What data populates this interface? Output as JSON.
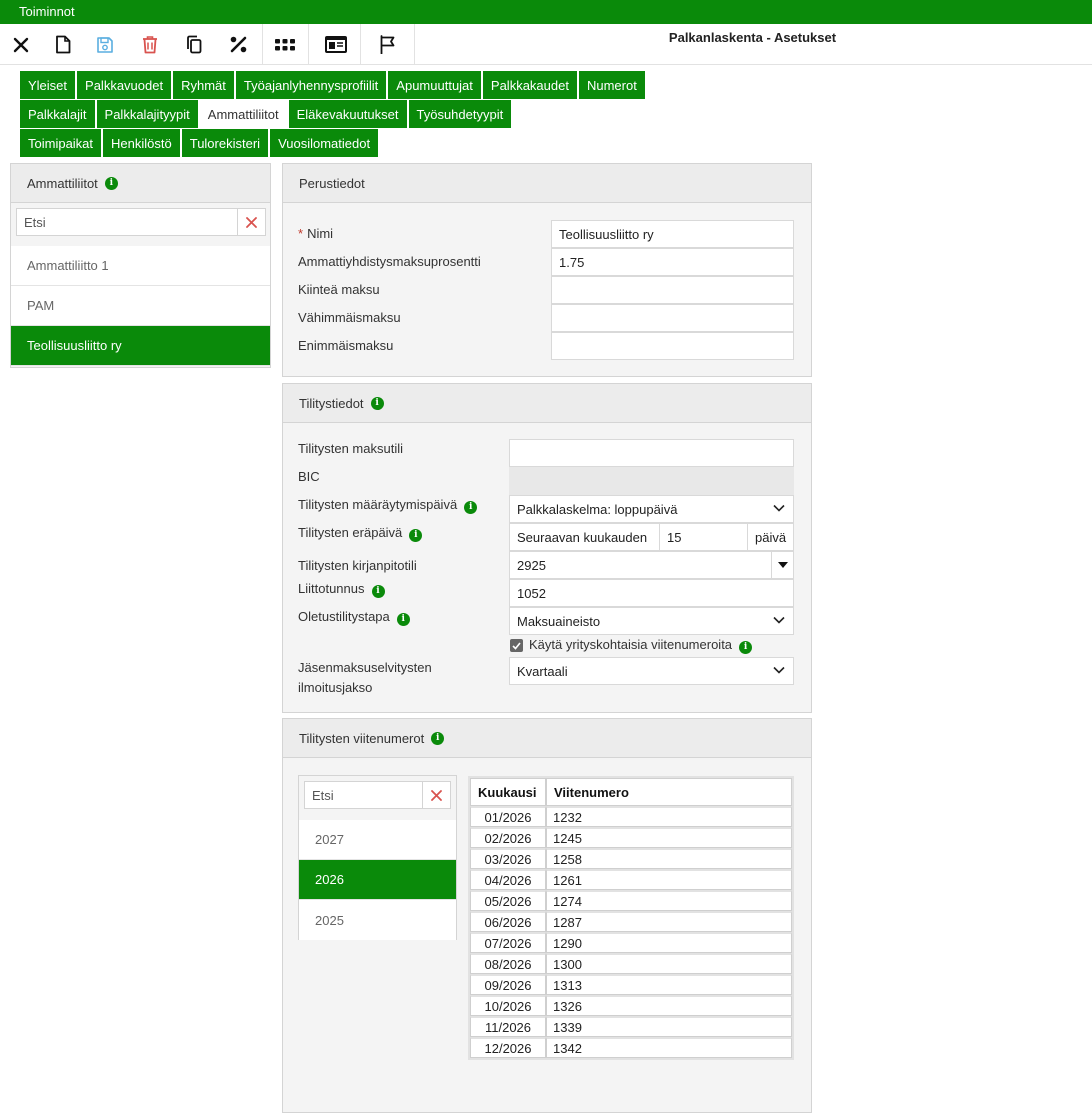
{
  "menu": {
    "title": "Toiminnot"
  },
  "toolbar": {
    "icons": [
      "close-icon",
      "new-document-icon",
      "save-icon",
      "delete-icon",
      "copy-icon",
      "percent-icon",
      "grid-icon",
      "id-card-icon",
      "flag-icon"
    ],
    "app_title": "Palkanlaskenta - Asetukset"
  },
  "tabs": {
    "row1": [
      "Yleiset",
      "Palkkavuodet",
      "Ryhmät",
      "Työajanlyhennysprofiilit",
      "Apumuuttujat",
      "Palkkakaudet",
      "Numerot"
    ],
    "row2": [
      "Palkkalajit",
      "Palkkalajityypit",
      "Ammattiliitot",
      "Eläkevakuutukset",
      "Työsuhdetyypit"
    ],
    "row3": [
      "Toimipaikat",
      "Henkilöstö",
      "Tulorekisteri",
      "Vuosilomatiedot"
    ],
    "active": "Ammattiliitot"
  },
  "sidebar": {
    "title": "Ammattiliitot",
    "search_placeholder": "Etsi",
    "items": [
      "Ammattiliitto 1",
      "PAM",
      "Teollisuusliitto ry"
    ],
    "selected": "Teollisuusliitto ry"
  },
  "basic": {
    "title": "Perustiedot",
    "required_mark": "*",
    "name_label": "Nimi",
    "name_value": "Teollisuusliitto ry",
    "percent_label": "Ammattiyhdistysmaksuprosentti",
    "percent_value": "1.75",
    "fixed_label": "Kiinteä maksu",
    "fixed_value": "",
    "min_label": "Vähimmäismaksu",
    "min_value": "",
    "max_label": "Enimmäismaksu",
    "max_value": ""
  },
  "settlement": {
    "title": "Tilitystiedot",
    "account_label": "Tilitysten maksutili",
    "account_value": "",
    "bic_label": "BIC",
    "bic_value": "",
    "determination_label": "Tilitysten määräytymispäivä",
    "determination_value": "Palkkalaskelma: loppupäivä",
    "due_label": "Tilitysten eräpäivä",
    "due_prefix": "Seuraavan kuukauden",
    "due_day": "15",
    "due_suffix": "päivä",
    "bookkeeping_label": "Tilitysten kirjanpitotili",
    "bookkeeping_value": "2925",
    "union_code_label": "Liittotunnus",
    "union_code_value": "1052",
    "method_label": "Oletustilitystapa",
    "method_value": "Maksuaineisto",
    "company_refs_label": "Käytä yrityskohtaisia viitenumeroita",
    "company_refs_checked": true,
    "report_period_label_1": "Jäsenmaksuselvitysten",
    "report_period_label_2": "ilmoitusjakso",
    "report_period_value": "Kvartaali"
  },
  "references": {
    "title": "Tilitysten viitenumerot",
    "search_placeholder": "Etsi",
    "years": [
      "2027",
      "2026",
      "2025"
    ],
    "selected_year": "2026",
    "headers": [
      "Kuukausi",
      "Viitenumero"
    ],
    "rows": [
      [
        "01/2026",
        "1232"
      ],
      [
        "02/2026",
        "1245"
      ],
      [
        "03/2026",
        "1258"
      ],
      [
        "04/2026",
        "1261"
      ],
      [
        "05/2026",
        "1274"
      ],
      [
        "06/2026",
        "1287"
      ],
      [
        "07/2026",
        "1290"
      ],
      [
        "08/2026",
        "1300"
      ],
      [
        "09/2026",
        "1313"
      ],
      [
        "10/2026",
        "1326"
      ],
      [
        "11/2026",
        "1339"
      ],
      [
        "12/2026",
        "1342"
      ]
    ]
  }
}
